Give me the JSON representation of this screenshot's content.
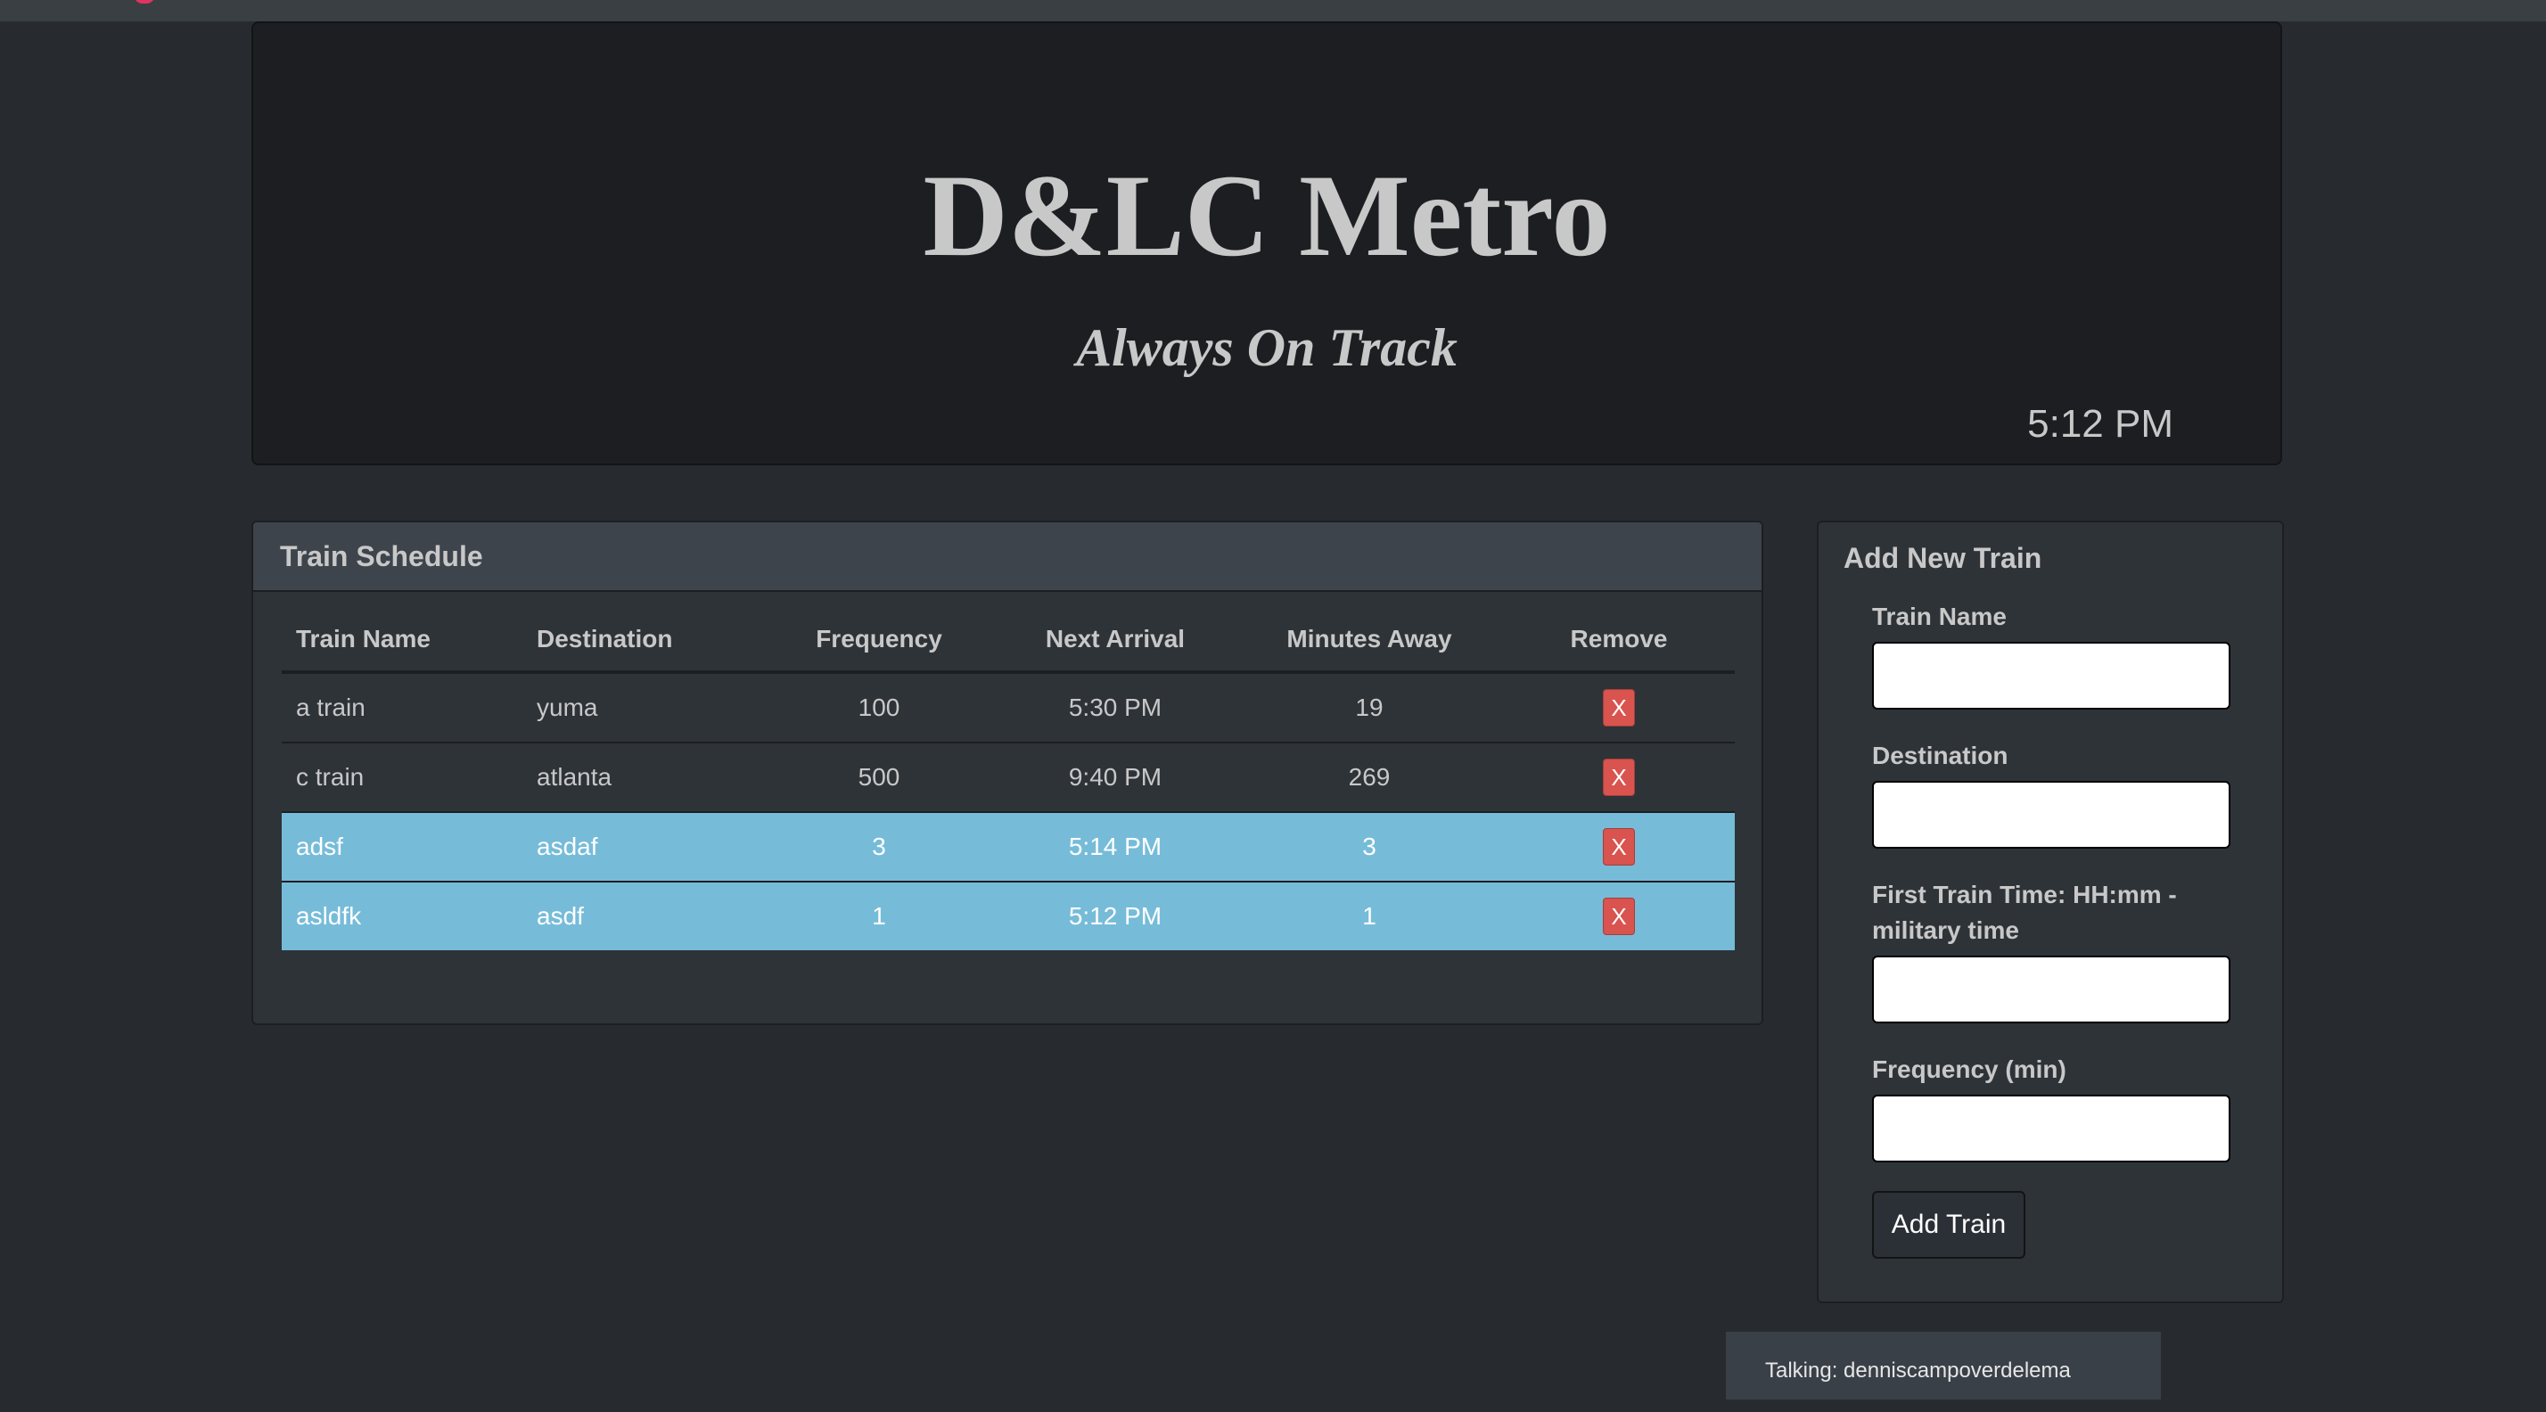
{
  "header": {
    "title": "D&LC Metro",
    "subtitle": "Always On Track",
    "time": "5:12 PM"
  },
  "schedule": {
    "title": "Train Schedule",
    "columns": [
      "Train Name",
      "Destination",
      "Frequency",
      "Next Arrival",
      "Minutes Away",
      "Remove"
    ],
    "rows": [
      {
        "name": "a train",
        "destination": "yuma",
        "frequency": "100",
        "next_arrival": "5:30 PM",
        "minutes_away": "19",
        "remove": "X",
        "highlighted": false
      },
      {
        "name": "c train",
        "destination": "atlanta",
        "frequency": "500",
        "next_arrival": "9:40 PM",
        "minutes_away": "269",
        "remove": "X",
        "highlighted": false
      },
      {
        "name": "adsf",
        "destination": "asdaf",
        "frequency": "3",
        "next_arrival": "5:14 PM",
        "minutes_away": "3",
        "remove": "X",
        "highlighted": true
      },
      {
        "name": "asldfk",
        "destination": "asdf",
        "frequency": "1",
        "next_arrival": "5:12 PM",
        "minutes_away": "1",
        "remove": "X",
        "highlighted": true
      }
    ]
  },
  "form": {
    "title": "Add New Train",
    "fields": [
      {
        "label": "Train Name",
        "value": "",
        "placeholder": ""
      },
      {
        "label": "Destination",
        "value": "",
        "placeholder": ""
      },
      {
        "label": "First Train Time: HH:mm - military time",
        "value": "",
        "placeholder": ""
      },
      {
        "label": "Frequency (min)",
        "value": "",
        "placeholder": ""
      }
    ],
    "submit_label": "Add Train"
  },
  "status": {
    "talking": "Talking: denniscampoverdelema"
  },
  "colors": {
    "background": "#272b30",
    "highlight_row": "#76bcd9",
    "remove_button": "#d9534f"
  }
}
